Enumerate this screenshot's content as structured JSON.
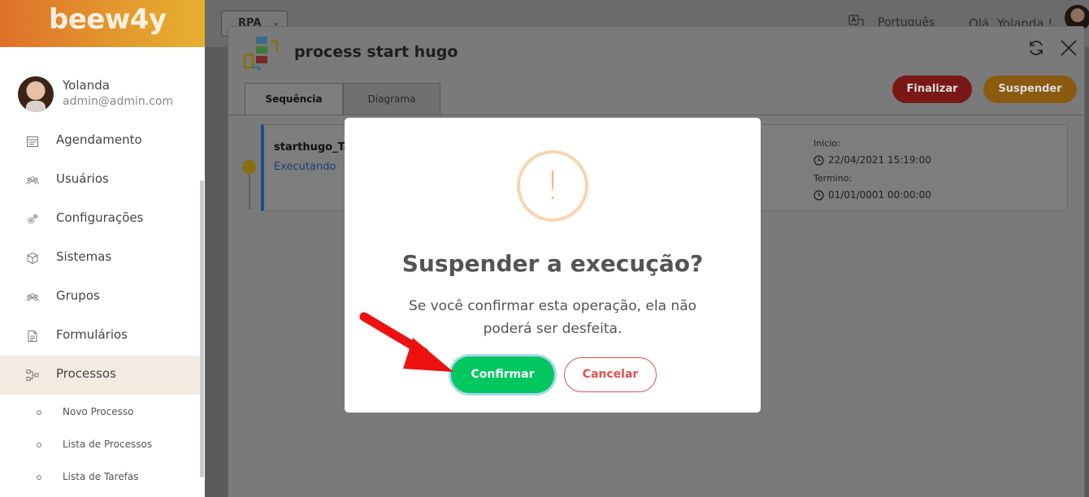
{
  "app": {
    "logo": "beew4y"
  },
  "user": {
    "name": "Yolanda",
    "email": "admin@admin.com"
  },
  "sidebar": {
    "items": [
      {
        "label": "Agendamento",
        "icon": "calendar-icon"
      },
      {
        "label": "Usuários",
        "icon": "users-icon"
      },
      {
        "label": "Configurações",
        "icon": "gears-icon"
      },
      {
        "label": "Sistemas",
        "icon": "cube-icon"
      },
      {
        "label": "Grupos",
        "icon": "groups-icon"
      },
      {
        "label": "Formulários",
        "icon": "document-icon"
      },
      {
        "label": "Processos",
        "icon": "process-icon",
        "active": true
      }
    ],
    "sub_items": [
      {
        "label": "Novo Processo"
      },
      {
        "label": "Lista de Processos"
      },
      {
        "label": "Lista de Tarefas"
      }
    ]
  },
  "topbar": {
    "rpa_select": "RPA",
    "language": "Português",
    "greeting": "Olá, Yolanda !"
  },
  "process": {
    "title": "process start hugo",
    "tabs": [
      {
        "label": "Sequência",
        "active": true
      },
      {
        "label": "Diagrama"
      }
    ],
    "finalize_label": "Finalizar",
    "suspend_label": "Suspender",
    "task": {
      "name": "starthugo_Ta",
      "status": "Executando",
      "start_label": "Inicio:",
      "start_value": "22/04/2021 15:19:00",
      "end_label": "Termino:",
      "end_value": "01/01/0001 00:00:00"
    }
  },
  "modal": {
    "icon": "!",
    "title": "Suspender a execução?",
    "text": "Se você confirmar esta operação, ela não poderá ser desfeita.",
    "confirm_label": "Confirmar",
    "cancel_label": "Cancelar"
  },
  "colors": {
    "brand_gradient_start": "#e0702a",
    "brand_gradient_end": "#e6b030",
    "confirm": "#00c85f",
    "cancel": "#e25050",
    "warning": "#f5b488",
    "annotation_arrow": "#ee1111"
  }
}
